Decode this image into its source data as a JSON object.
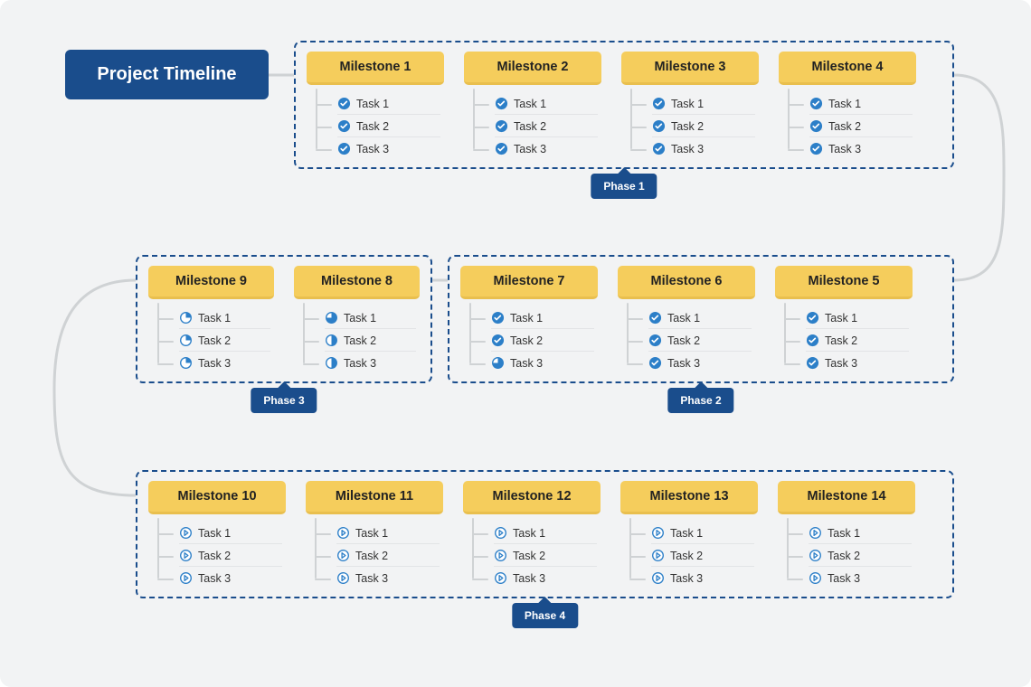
{
  "title": "Project Timeline",
  "phases": [
    {
      "label": "Phase 1",
      "milestones": [
        {
          "name": "Milestone 1",
          "tasks": [
            {
              "label": "Task 1",
              "status": "done"
            },
            {
              "label": "Task 2",
              "status": "done"
            },
            {
              "label": "Task 3",
              "status": "done"
            }
          ]
        },
        {
          "name": "Milestone 2",
          "tasks": [
            {
              "label": "Task 1",
              "status": "done"
            },
            {
              "label": "Task 2",
              "status": "done"
            },
            {
              "label": "Task 3",
              "status": "done"
            }
          ]
        },
        {
          "name": "Milestone 3",
          "tasks": [
            {
              "label": "Task 1",
              "status": "done"
            },
            {
              "label": "Task 2",
              "status": "done"
            },
            {
              "label": "Task 3",
              "status": "done"
            }
          ]
        },
        {
          "name": "Milestone 4",
          "tasks": [
            {
              "label": "Task 1",
              "status": "done"
            },
            {
              "label": "Task 2",
              "status": "done"
            },
            {
              "label": "Task 3",
              "status": "done"
            }
          ]
        }
      ]
    },
    {
      "label": "Phase 2",
      "milestones": [
        {
          "name": "Milestone 7",
          "tasks": [
            {
              "label": "Task 1",
              "status": "done"
            },
            {
              "label": "Task 2",
              "status": "done"
            },
            {
              "label": "Task 3",
              "status": "progress-75"
            }
          ]
        },
        {
          "name": "Milestone 6",
          "tasks": [
            {
              "label": "Task 1",
              "status": "done"
            },
            {
              "label": "Task 2",
              "status": "done"
            },
            {
              "label": "Task 3",
              "status": "done"
            }
          ]
        },
        {
          "name": "Milestone 5",
          "tasks": [
            {
              "label": "Task 1",
              "status": "done"
            },
            {
              "label": "Task 2",
              "status": "done"
            },
            {
              "label": "Task 3",
              "status": "done"
            }
          ]
        }
      ]
    },
    {
      "label": "Phase 3",
      "milestones": [
        {
          "name": "Milestone 9",
          "tasks": [
            {
              "label": "Task 1",
              "status": "progress-25"
            },
            {
              "label": "Task 2",
              "status": "progress-25"
            },
            {
              "label": "Task 3",
              "status": "progress-25"
            }
          ]
        },
        {
          "name": "Milestone 8",
          "tasks": [
            {
              "label": "Task 1",
              "status": "progress-75"
            },
            {
              "label": "Task 2",
              "status": "progress-50"
            },
            {
              "label": "Task 3",
              "status": "progress-50"
            }
          ]
        }
      ]
    },
    {
      "label": "Phase 4",
      "milestones": [
        {
          "name": "Milestone 10",
          "tasks": [
            {
              "label": "Task 1",
              "status": "pending"
            },
            {
              "label": "Task 2",
              "status": "pending"
            },
            {
              "label": "Task 3",
              "status": "pending"
            }
          ]
        },
        {
          "name": "Milestone 11",
          "tasks": [
            {
              "label": "Task 1",
              "status": "pending"
            },
            {
              "label": "Task 2",
              "status": "pending"
            },
            {
              "label": "Task 3",
              "status": "pending"
            }
          ]
        },
        {
          "name": "Milestone 12",
          "tasks": [
            {
              "label": "Task 1",
              "status": "pending"
            },
            {
              "label": "Task 2",
              "status": "pending"
            },
            {
              "label": "Task 3",
              "status": "pending"
            }
          ]
        },
        {
          "name": "Milestone 13",
          "tasks": [
            {
              "label": "Task 1",
              "status": "pending"
            },
            {
              "label": "Task 2",
              "status": "pending"
            },
            {
              "label": "Task 3",
              "status": "pending"
            }
          ]
        },
        {
          "name": "Milestone 14",
          "tasks": [
            {
              "label": "Task 1",
              "status": "pending"
            },
            {
              "label": "Task 2",
              "status": "pending"
            },
            {
              "label": "Task 3",
              "status": "pending"
            }
          ]
        }
      ]
    }
  ]
}
